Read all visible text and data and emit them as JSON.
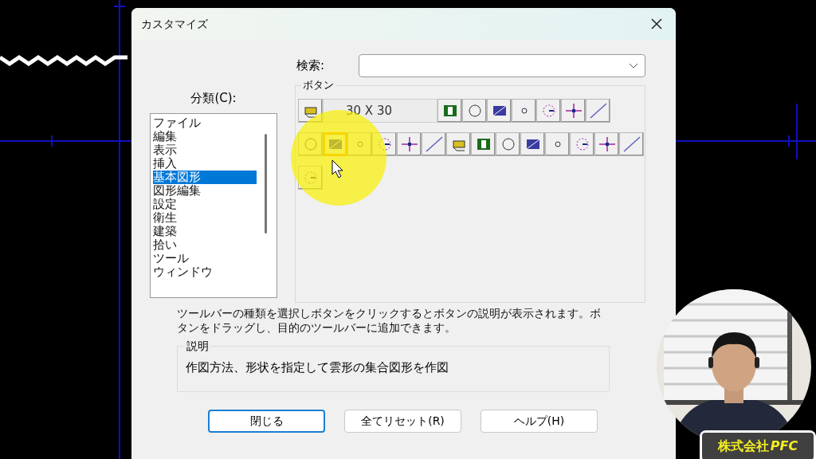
{
  "window": {
    "title": "カスタマイズ"
  },
  "search": {
    "label": "検索:"
  },
  "category": {
    "label": "分類(C):",
    "items": [
      {
        "label": "ファイル",
        "selected": false
      },
      {
        "label": "編集",
        "selected": false
      },
      {
        "label": "表示",
        "selected": false
      },
      {
        "label": "挿入",
        "selected": false
      },
      {
        "label": "基本図形",
        "selected": true
      },
      {
        "label": "図形編集",
        "selected": false
      },
      {
        "label": "設定",
        "selected": false
      },
      {
        "label": "衛生",
        "selected": false
      },
      {
        "label": "建築",
        "selected": false
      },
      {
        "label": "拾い",
        "selected": false
      },
      {
        "label": "ツール",
        "selected": false
      },
      {
        "label": "ウィンドウ",
        "selected": false
      }
    ]
  },
  "buttons_group": {
    "title": "ボタン",
    "size": "30 X 30",
    "rows": [
      [
        {
          "selected": false
        },
        {
          "selected": false
        },
        {
          "selected": false
        },
        {
          "selected": false
        },
        {
          "selected": false
        },
        {
          "selected": false
        },
        {
          "selected": false
        },
        {
          "selected": false
        }
      ],
      [
        {
          "selected": false
        },
        {
          "selected": true
        },
        {
          "selected": false
        },
        {
          "selected": false
        },
        {
          "selected": false
        },
        {
          "selected": false
        },
        {
          "selected": false
        },
        {
          "selected": false
        },
        {
          "selected": false
        },
        {
          "selected": false
        },
        {
          "selected": false
        },
        {
          "selected": false
        },
        {
          "selected": false
        },
        {
          "selected": false
        }
      ],
      [
        {
          "selected": false
        }
      ]
    ]
  },
  "hint": "ツールバーの種類を選択しボタンをクリックするとボタンの説明が表示されます。ボタンをドラッグし、目的のツールバーに追加できます。",
  "description": {
    "title": "説明",
    "text": "作図方法、形状を指定して雲形の集合図形を作図"
  },
  "actions": [
    {
      "label": "閉じる",
      "default": true
    },
    {
      "label": "全てリセット(R)",
      "default": false
    },
    {
      "label": "ヘルプ(H)",
      "default": false
    }
  ],
  "presenter": {
    "kind": "picture",
    "caption": "株式会社",
    "brand": "PFC"
  }
}
